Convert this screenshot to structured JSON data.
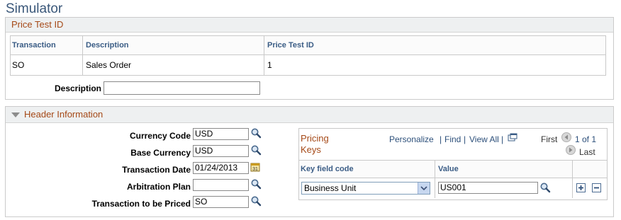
{
  "page": {
    "title": "Simulator"
  },
  "price_test": {
    "section_title": "Price Test ID",
    "columns": [
      "Transaction",
      "Description",
      "Price Test ID"
    ],
    "rows": [
      {
        "transaction": "SO",
        "description": "Sales Order",
        "price_test_id": "1"
      }
    ],
    "description_label": "Description",
    "description_value": ""
  },
  "header": {
    "section_title": "Header Information",
    "currency_code": {
      "label": "Currency Code",
      "value": "USD"
    },
    "base_currency": {
      "label": "Base Currency",
      "value": "USD"
    },
    "transaction_date": {
      "label": "Transaction Date",
      "value": "01/24/2013"
    },
    "arbitration_plan": {
      "label": "Arbitration Plan",
      "value": ""
    },
    "transaction_to_price": {
      "label": "Transaction to be Priced",
      "value": "SO"
    }
  },
  "pricing_keys": {
    "title_line1": "Pricing",
    "title_line2": "Keys",
    "personalize": "Personalize",
    "find": "Find",
    "view_all": "View All",
    "separator": "|",
    "first": "First",
    "page_info": "1 of 1",
    "last": "Last",
    "columns": [
      "Key field code",
      "Value"
    ],
    "rows": [
      {
        "key_field_code": "Business Unit",
        "value": "US001"
      }
    ]
  },
  "icons": {
    "lookup": "magnifier-icon",
    "calendar": "calendar-icon",
    "add": "plus-icon",
    "delete": "minus-icon"
  }
}
